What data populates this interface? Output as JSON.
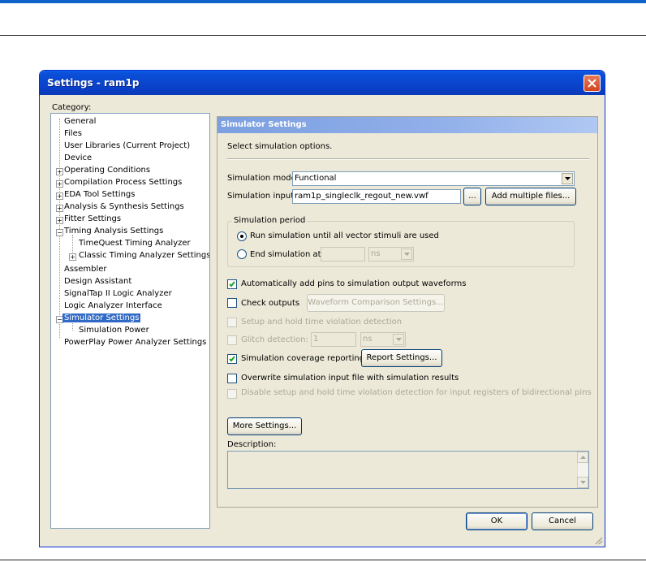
{
  "window": {
    "title": "Settings - ram1p"
  },
  "category": {
    "label": "Category:",
    "items": [
      {
        "label": "General"
      },
      {
        "label": "Files"
      },
      {
        "label": "User Libraries (Current Project)"
      },
      {
        "label": "Device"
      },
      {
        "label": "Operating Conditions"
      },
      {
        "label": "Compilation Process Settings"
      },
      {
        "label": "EDA Tool Settings"
      },
      {
        "label": "Analysis & Synthesis Settings"
      },
      {
        "label": "Fitter Settings"
      },
      {
        "label": "Timing Analysis Settings"
      },
      {
        "label": "TimeQuest Timing Analyzer"
      },
      {
        "label": "Classic Timing Analyzer Settings"
      },
      {
        "label": "Assembler"
      },
      {
        "label": "Design Assistant"
      },
      {
        "label": "SignalTap II Logic Analyzer"
      },
      {
        "label": "Logic Analyzer Interface"
      },
      {
        "label": "Simulator Settings"
      },
      {
        "label": "Simulation Power"
      },
      {
        "label": "PowerPlay Power Analyzer Settings"
      }
    ]
  },
  "panel": {
    "header": "Simulator Settings",
    "intro": "Select simulation options.",
    "sim_mode_label": "Simulation mode:",
    "sim_mode_value": "Functional",
    "sim_input_label": "Simulation input:",
    "sim_input_value": "ram1p_singleclk_regout_new.vwf",
    "browse_label": "...",
    "add_files_label": "Add multiple files...",
    "period_title": "Simulation period",
    "run_all_label": "Run simulation until all vector stimuli are used",
    "end_at_label": "End simulation at:",
    "end_at_value": "",
    "end_at_unit": "ns",
    "auto_add_pins_label": "Automatically add pins to simulation output waveforms",
    "check_outputs_label": "Check outputs",
    "waveform_compare_label": "Waveform Comparison Settings...",
    "setup_hold_label": "Setup and hold time violation detection",
    "glitch_label": "Glitch detection:",
    "glitch_value": "1",
    "glitch_unit": "ns",
    "coverage_label": "Simulation coverage reporting",
    "report_settings_label": "Report Settings...",
    "overwrite_label": "Overwrite simulation input file with simulation results",
    "disable_setup_label": "Disable setup and hold time violation detection for input registers of bidirectional pins",
    "more_settings_label": "More Settings...",
    "description_label": "Description:"
  },
  "footer": {
    "ok_label": "OK",
    "cancel_label": "Cancel"
  }
}
